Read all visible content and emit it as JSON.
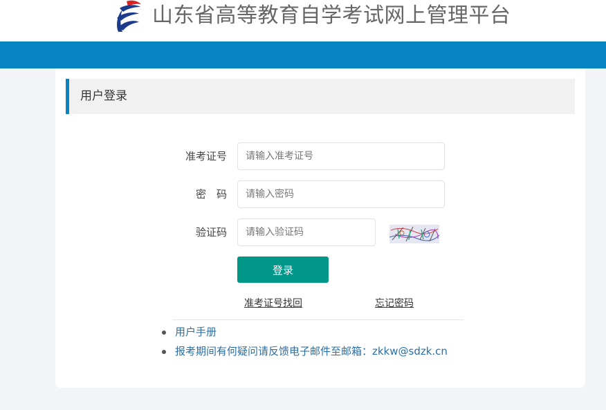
{
  "header": {
    "site_title": "山东省高等教育自学考试网上管理平台",
    "logo_icon": "sdzk-logo-icon",
    "bar_color": "#0785c2"
  },
  "panel": {
    "title": "用户登录"
  },
  "form": {
    "exam_id_label": "准考证号",
    "exam_id_placeholder": "请输入准考证号",
    "exam_id_value": "",
    "password_label": "密　码",
    "password_placeholder": "请输入密码",
    "password_value": "",
    "captcha_label": "验证码",
    "captcha_placeholder": "请输入验证码",
    "captcha_value": "",
    "captcha_icon": "captcha-image",
    "login_label": "登录",
    "login_color": "#009688"
  },
  "links": {
    "recover_id": "准考证号找回",
    "forgot_password": "忘记密码"
  },
  "info": {
    "items": [
      "用户手册",
      "报考期间有何疑问请反馈电子邮件至邮箱：zkkw@sdzk.cn"
    ]
  }
}
